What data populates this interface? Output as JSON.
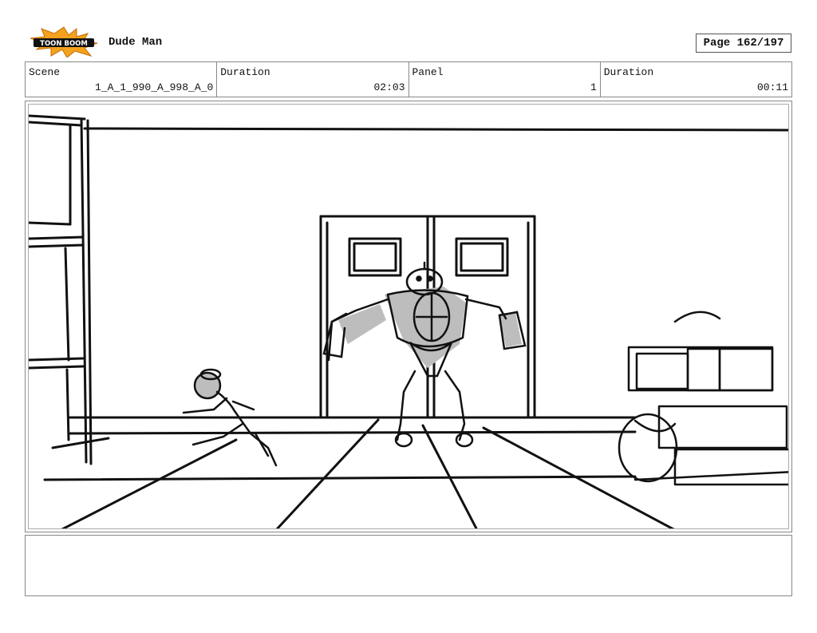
{
  "header": {
    "logo_text": "TOON BOOM",
    "project_title": "Dude Man",
    "page_label": "Page 162/197"
  },
  "info": {
    "scene_label": "Scene",
    "scene_value": "1_A_1_990_A_998_A_0",
    "duration_label": "Duration",
    "duration_value": "02:03",
    "panel_label": "Panel",
    "panel_value": "1",
    "panel_duration_label": "Duration",
    "panel_duration_value": "00:11"
  },
  "notes": {
    "text": ""
  }
}
